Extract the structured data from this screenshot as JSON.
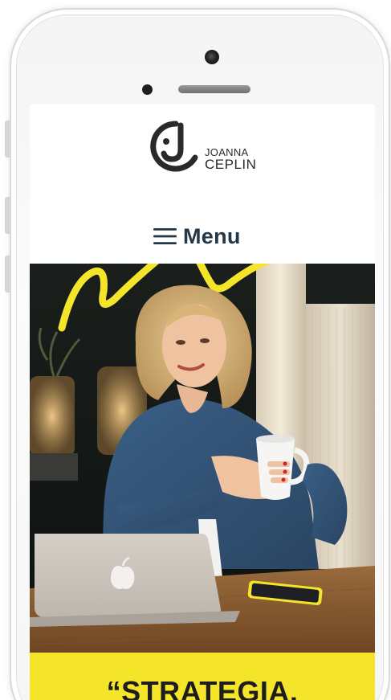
{
  "brand": {
    "first_name": "JOANNA",
    "last_name": "CEPLIN",
    "logo_icon": "jc-smile-logo"
  },
  "nav": {
    "menu_label": "Menu",
    "menu_icon": "hamburger-icon"
  },
  "hero": {
    "accent_color": "#f4e52b",
    "banner_text": "“STRATEGIA,"
  },
  "colors": {
    "accent": "#f4e52b",
    "menu_text": "#243746",
    "logo": "#2a2a2a"
  }
}
